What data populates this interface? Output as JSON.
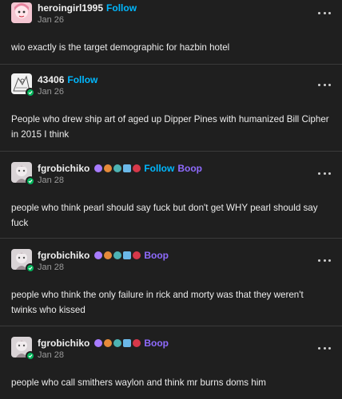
{
  "posts": [
    {
      "username": "heroingirl1995",
      "action": "Follow",
      "date": "Jan 26",
      "text": "wio exactly is the target demographic for hazbin hotel"
    },
    {
      "username": "43406",
      "action": "Follow",
      "date": "Jan 26",
      "text": "People who drew ship art of aged up Dipper Pines with humanized Bill Cipher in 2015 I think"
    },
    {
      "username": "fgrobichiko",
      "action_follow": "Follow",
      "action_boop": "Boop",
      "date": "Jan 28",
      "text": "people who think pearl should say fuck but don't get WHY pearl should say fuck"
    },
    {
      "username": "fgrobichiko",
      "action_boop": "Boop",
      "date": "Jan 28",
      "text": "people who think the only failure in rick and morty was that they weren't twinks who kissed"
    },
    {
      "username": "fgrobichiko",
      "action_boop": "Boop",
      "date": "Jan 28",
      "text": "people who call smithers waylon and think mr burns doms him"
    }
  ],
  "icons": {
    "more": "more-options-icon",
    "badge": "check-badge-icon"
  },
  "colors": {
    "background": "#1f1f1f",
    "follow": "#00b8ff",
    "boop": "#8f6bff",
    "badge": "#00b359",
    "divider": "#3a3a3a"
  }
}
